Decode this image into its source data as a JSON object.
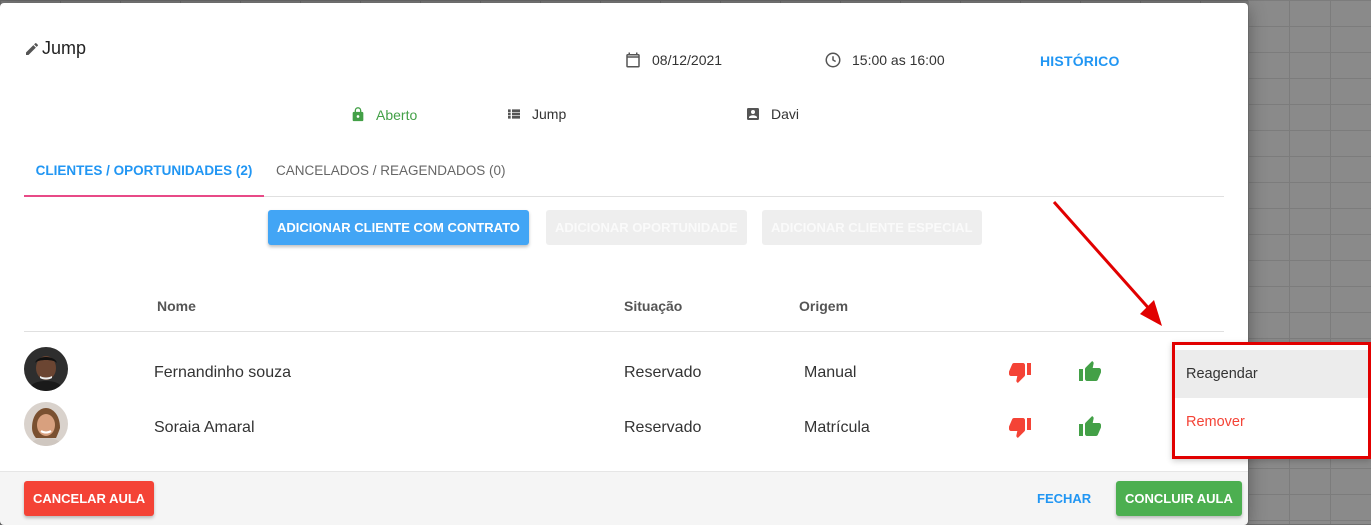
{
  "colors": {
    "primary": "#2196f3",
    "danger": "#f44336",
    "success": "#4caf50",
    "tab_indicator": "#e84a87",
    "annotation": "#e10000"
  },
  "header": {
    "title": "Jump",
    "date": "08/12/2021",
    "time": "15:00 as 16:00",
    "history_label": "HISTÓRICO",
    "status": "Aberto",
    "activity": "Jump",
    "instructor": "Davi"
  },
  "tabs": [
    {
      "label": "CLIENTES / OPORTUNIDADES (2)",
      "active": true
    },
    {
      "label": "CANCELADOS / REAGENDADOS (0)",
      "active": false
    }
  ],
  "actions": {
    "add_contract": "ADICIONAR CLIENTE COM CONTRATO",
    "add_opportunity": "ADICIONAR OPORTUNIDADE",
    "add_special": "ADICIONAR CLIENTE ESPECIAL"
  },
  "table": {
    "headers": {
      "name": "Nome",
      "status": "Situação",
      "origin": "Origem"
    },
    "rows": [
      {
        "name": "Fernandinho souza",
        "status": "Reservado",
        "origin": "Manual"
      },
      {
        "name": "Soraia Amaral",
        "status": "Reservado",
        "origin": "Matrícula"
      }
    ]
  },
  "context_menu": {
    "items": [
      "Reagendar",
      "Remover"
    ]
  },
  "footer": {
    "cancel": "CANCELAR AULA",
    "close": "FECHAR",
    "complete": "CONCLUIR AULA"
  }
}
